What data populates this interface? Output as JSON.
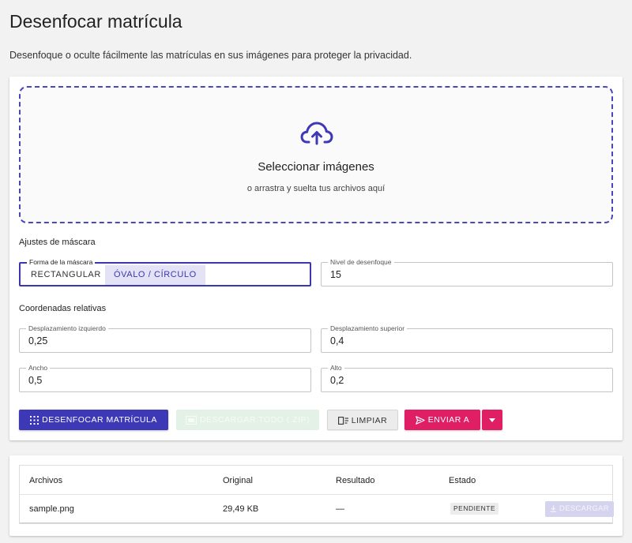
{
  "page": {
    "title": "Desenfocar matrícula",
    "description": "Desenfoque o oculte fácilmente las matrículas en sus imágenes para proteger la privacidad."
  },
  "dropzone": {
    "icon": "cloud-upload-icon",
    "title": "Seleccionar imágenes",
    "subtitle": "o arrastra y suelta tus archivos aquí"
  },
  "mask_settings": {
    "heading": "Ajustes de máscara",
    "shape": {
      "label": "Forma de la máscara",
      "options": [
        "RECTANGULAR",
        "ÓVALO / CÍRCULO"
      ],
      "selected": "ÓVALO / CÍRCULO"
    },
    "blur_level": {
      "label": "Nivel de desenfoque",
      "value": "15"
    }
  },
  "coordinates": {
    "heading": "Coordenadas relativas",
    "offset_left": {
      "label": "Desplazamiento izquierdo",
      "value": "0,25"
    },
    "offset_top": {
      "label": "Desplazamiento superior",
      "value": "0,4"
    },
    "width": {
      "label": "Ancho",
      "value": "0,5"
    },
    "height": {
      "label": "Alto",
      "value": "0,2"
    }
  },
  "actions": {
    "blur": "DESENFOCAR MATRÍCULA",
    "download_all": "DESCARGAR TODO (.ZIP)",
    "clear": "LIMPIAR",
    "send_to": "ENVIAR A"
  },
  "files_table": {
    "columns": [
      "Archivos",
      "Original",
      "Resultado",
      "Estado"
    ],
    "rows": [
      {
        "file": "sample.png",
        "original": "29,49 KB",
        "result": "—",
        "status": "PENDIENTE",
        "action": "DESCARGAR"
      }
    ]
  },
  "colors": {
    "primary": "#3d39b6",
    "accent": "#e01e63",
    "background": "#f2f2f2"
  }
}
